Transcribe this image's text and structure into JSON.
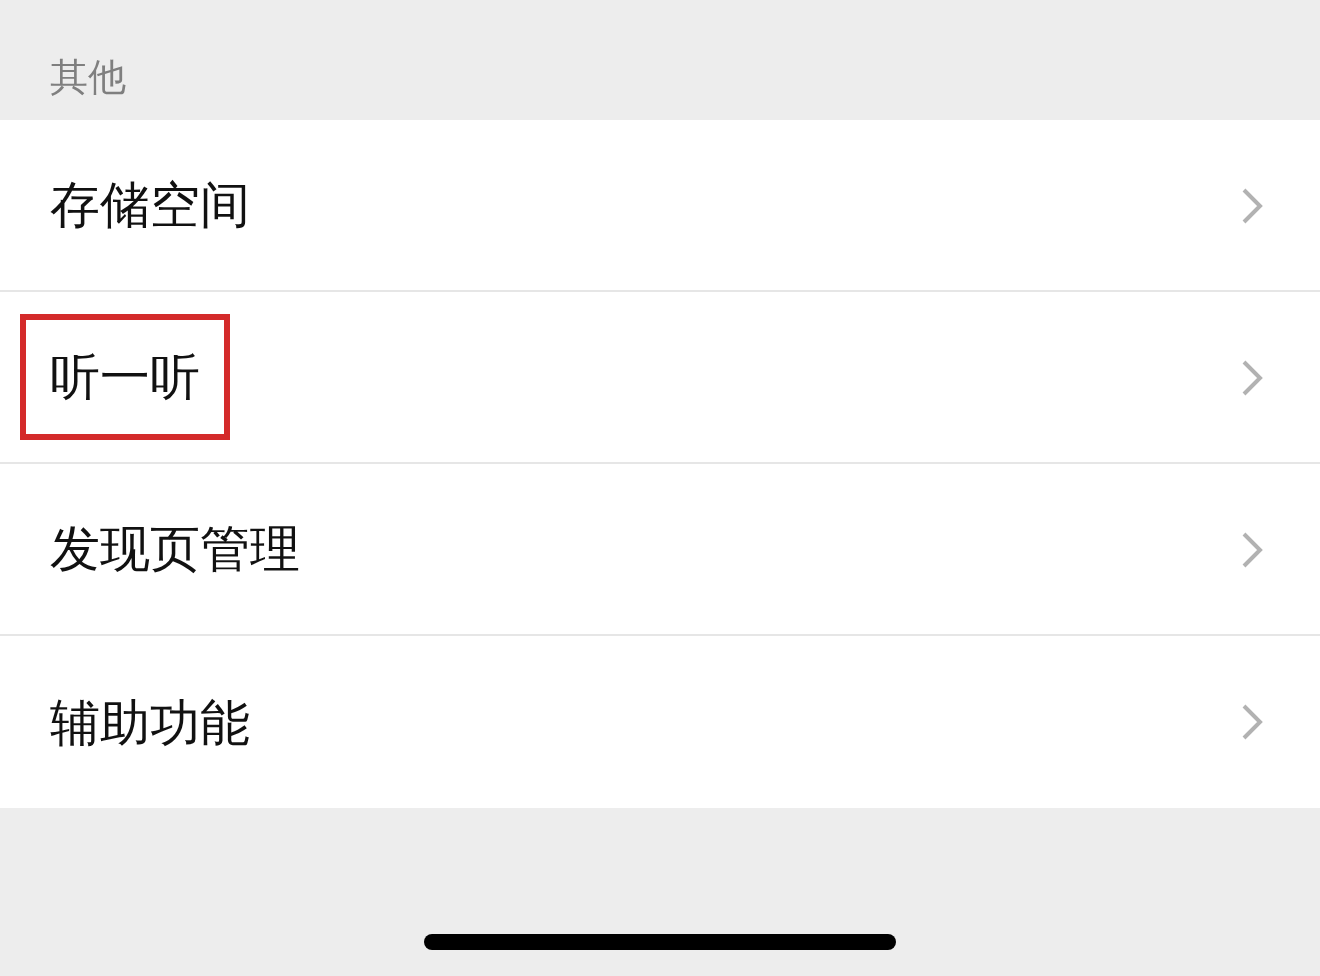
{
  "section": {
    "title": "其他"
  },
  "items": [
    {
      "label": "存储空间",
      "highlighted": false
    },
    {
      "label": "听一听",
      "highlighted": true
    },
    {
      "label": "发现页管理",
      "highlighted": false
    },
    {
      "label": "辅助功能",
      "highlighted": false
    }
  ]
}
